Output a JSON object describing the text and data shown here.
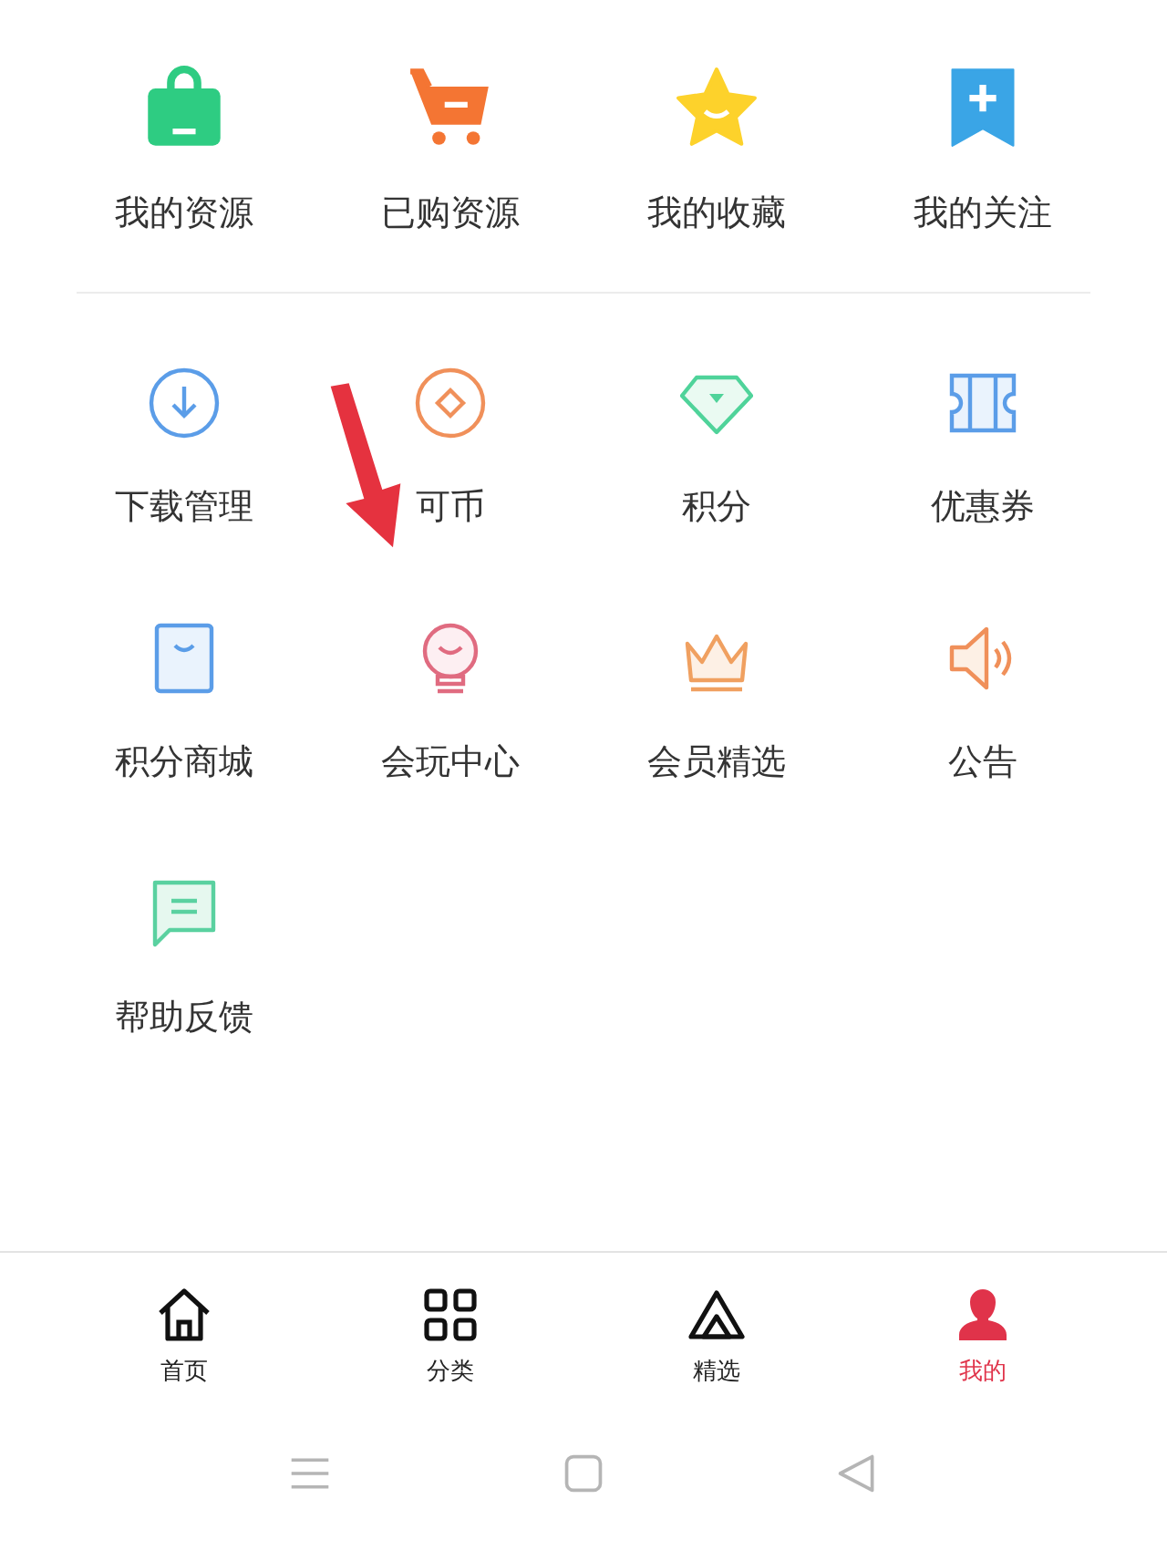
{
  "top_items": [
    {
      "label": "我的资源"
    },
    {
      "label": "已购资源"
    },
    {
      "label": "我的收藏"
    },
    {
      "label": "我的关注"
    }
  ],
  "grid_items": [
    {
      "label": "下载管理"
    },
    {
      "label": "可币"
    },
    {
      "label": "积分"
    },
    {
      "label": "优惠券"
    },
    {
      "label": "积分商城"
    },
    {
      "label": "会玩中心"
    },
    {
      "label": "会员精选"
    },
    {
      "label": "公告"
    },
    {
      "label": "帮助反馈"
    }
  ],
  "tabs": [
    {
      "label": "首页",
      "selected": false
    },
    {
      "label": "分类",
      "selected": false
    },
    {
      "label": "精选",
      "selected": false
    },
    {
      "label": "我的",
      "selected": true
    }
  ]
}
